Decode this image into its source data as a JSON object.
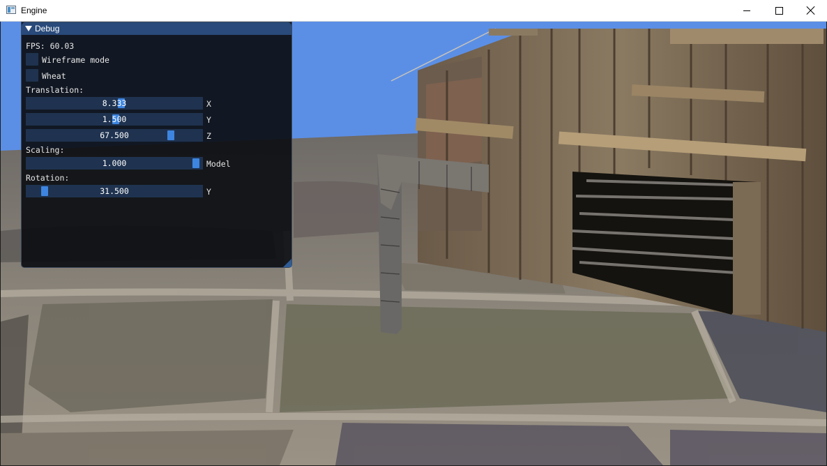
{
  "window": {
    "title": "Engine",
    "minimize_icon": "minimize-icon",
    "maximize_icon": "maximize-icon",
    "close_icon": "close-icon"
  },
  "debug": {
    "title": "Debug",
    "fps": "FPS: 60.03",
    "wireframe_label": "Wireframe mode",
    "wireframe_checked": false,
    "wheat_label": "Wheat",
    "wheat_checked": false,
    "translation_label": "Translation:",
    "translation": [
      {
        "value": "8.333",
        "axis": "X",
        "fill": 0.54
      },
      {
        "value": "1.500",
        "axis": "Y",
        "fill": 0.51
      },
      {
        "value": "67.500",
        "axis": "Z",
        "fill": 0.83
      }
    ],
    "scaling_label": "Scaling:",
    "scaling": {
      "value": "1.000",
      "axis": "Model",
      "fill": 0.98
    },
    "rotation_label": "Rotation:",
    "rotation": {
      "value": "31.500",
      "axis": "Y",
      "fill": 0.09
    }
  },
  "colors": {
    "sky": "#5b8fe6",
    "panel_header": "#294a7a",
    "slider_bg": "#1f3350",
    "slider_grab": "#3d85e0"
  }
}
